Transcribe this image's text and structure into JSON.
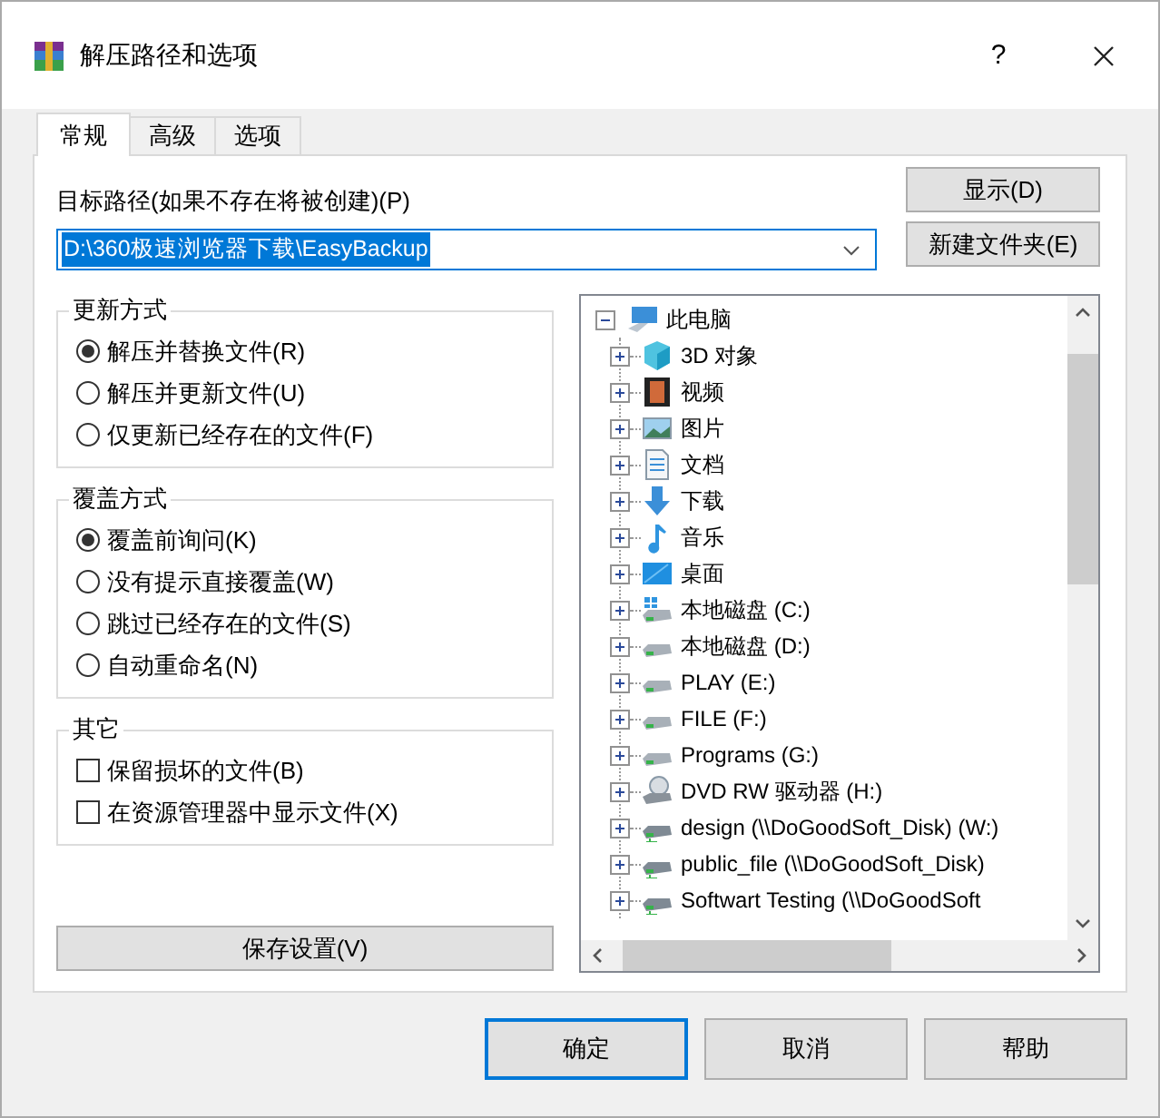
{
  "window": {
    "title": "解压路径和选项",
    "help_button": "?"
  },
  "tabs": [
    {
      "label": "常规",
      "selected": true
    },
    {
      "label": "高级",
      "selected": false
    },
    {
      "label": "选项",
      "selected": false
    }
  ],
  "destination": {
    "label": "目标路径(如果不存在将被创建)(P)",
    "value": "D:\\360极速浏览器下载\\EasyBackup"
  },
  "side_buttons": [
    "显示(D)",
    "新建文件夹(E)"
  ],
  "groups": [
    {
      "title": "更新方式",
      "kind": "radio",
      "options": [
        {
          "label": "解压并替换文件(R)",
          "selected": true
        },
        {
          "label": "解压并更新文件(U)",
          "selected": false
        },
        {
          "label": "仅更新已经存在的文件(F)",
          "selected": false
        }
      ]
    },
    {
      "title": "覆盖方式",
      "kind": "radio",
      "options": [
        {
          "label": "覆盖前询问(K)",
          "selected": true
        },
        {
          "label": "没有提示直接覆盖(W)",
          "selected": false
        },
        {
          "label": "跳过已经存在的文件(S)",
          "selected": false
        },
        {
          "label": "自动重命名(N)",
          "selected": false
        }
      ]
    },
    {
      "title": "其它",
      "kind": "checkbox",
      "options": [
        {
          "label": "保留损坏的文件(B)",
          "checked": false
        },
        {
          "label": "在资源管理器中显示文件(X)",
          "checked": false
        }
      ]
    }
  ],
  "save_button": "保存设置(V)",
  "folder_tree": {
    "label": "此电脑",
    "expanded": true,
    "children": [
      {
        "label": "3D 对象",
        "expanded": false
      },
      {
        "label": "视频",
        "expanded": false
      },
      {
        "label": "图片",
        "expanded": false
      },
      {
        "label": "文档",
        "expanded": false
      },
      {
        "label": "下载",
        "expanded": false
      },
      {
        "label": "音乐",
        "expanded": false
      },
      {
        "label": "桌面",
        "expanded": false
      },
      {
        "label": "本地磁盘 (C:)",
        "expanded": false
      },
      {
        "label": "本地磁盘 (D:)",
        "expanded": false
      },
      {
        "label": "PLAY (E:)",
        "expanded": false
      },
      {
        "label": "FILE (F:)",
        "expanded": false
      },
      {
        "label": "Programs (G:)",
        "expanded": false
      },
      {
        "label": "DVD RW 驱动器 (H:)",
        "expanded": false
      },
      {
        "label": "design (\\\\DoGoodSoft_Disk) (W:)",
        "expanded": false
      },
      {
        "label": "public_file (\\\\DoGoodSoft_Disk)",
        "expanded": false
      },
      {
        "label": "Softwart Testing (\\\\DoGoodSoft",
        "expanded": false
      }
    ]
  },
  "footer_buttons": [
    {
      "label": "确定",
      "default": true
    },
    {
      "label": "取消",
      "default": false
    },
    {
      "label": "帮助",
      "default": false
    }
  ]
}
